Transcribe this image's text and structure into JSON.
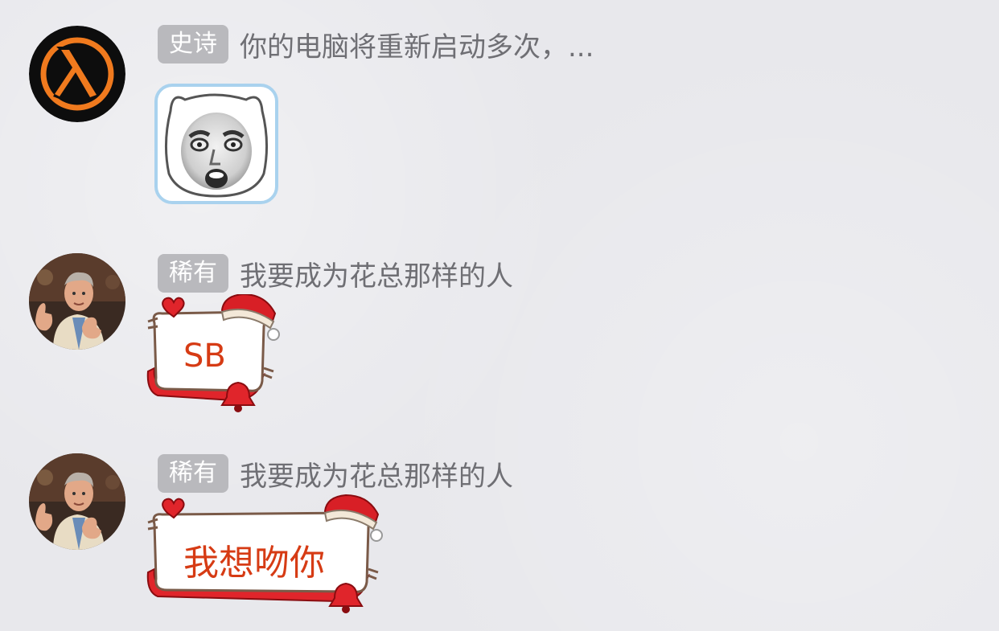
{
  "messages": [
    {
      "badge": "史诗",
      "name": "你的电脑将重新启动多次，...",
      "avatar": "half-life-lambda-icon",
      "content_type": "sticker",
      "sticker": "shocked-face-sticker"
    },
    {
      "badge": "稀有",
      "name": "我要成为花总那样的人",
      "avatar": "man-thumbs-up-photo",
      "content_type": "festive-bubble",
      "text": "SB"
    },
    {
      "badge": "稀有",
      "name": "我要成为花总那样的人",
      "avatar": "man-thumbs-up-photo",
      "content_type": "festive-bubble",
      "text": "我想吻你"
    }
  ],
  "colors": {
    "badge_bg": "#b9b9bd",
    "name_text": "#6f6f74",
    "bubble_border_blue": "#a9d2ee",
    "festive_red": "#e0252b",
    "festive_text": "#d63b14",
    "lambda_orange": "#f07a1e"
  }
}
